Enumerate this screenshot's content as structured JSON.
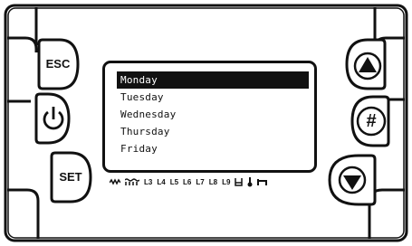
{
  "buttons": {
    "esc_label": "ESC",
    "set_label": "SET",
    "hash_label": "#"
  },
  "menu": {
    "items": [
      "Monday",
      "Tuesday",
      "Wednesday",
      "Thursday",
      "Friday"
    ],
    "selected_index": 0
  },
  "status_bar": {
    "labels": [
      "L3",
      "L4",
      "L5",
      "L6",
      "L7",
      "L8",
      "L9"
    ],
    "icons": [
      "heater-icon",
      "zigzag-icon",
      "tank-icon",
      "thermometer-icon",
      "tap-icon"
    ]
  }
}
